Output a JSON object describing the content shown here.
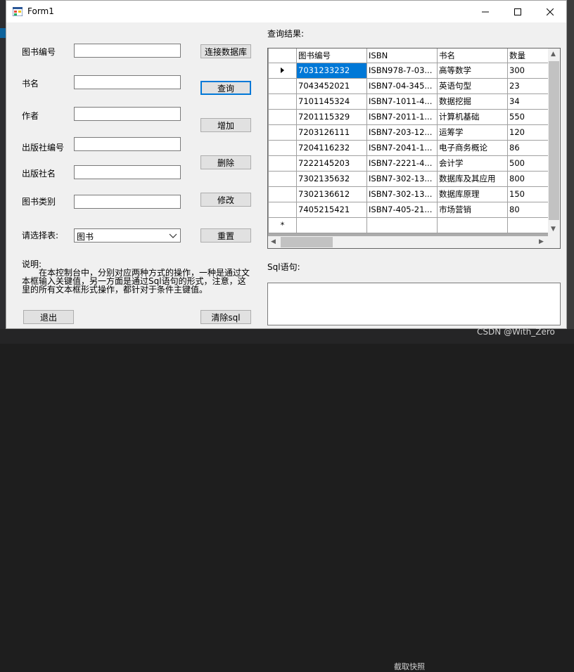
{
  "window": {
    "title": "Form1"
  },
  "form": {
    "labels": {
      "book_id": "图书编号",
      "book_name": "书名",
      "author": "作者",
      "publisher_id": "出版社编号",
      "publisher_name": "出版社名",
      "category": "图书类别",
      "choose_table": "请选择表:",
      "query_result": "查询结果:",
      "sql_statement": "Sql语句:"
    },
    "inputs": {
      "book_id": "",
      "book_name": "",
      "author": "",
      "publisher_id": "",
      "publisher_name": "",
      "category": ""
    },
    "table_select": {
      "value": "图书"
    },
    "buttons": {
      "connect": "连接数据库",
      "query": "查询",
      "add": "增加",
      "delete": "删除",
      "modify": "修改",
      "reset": "重置",
      "exit": "退出",
      "clear_sql": "清除sql"
    },
    "description": {
      "head": "说明:",
      "body": "在本控制台中，分别对应两种方式的操作，一种是通过文本框输入关键值，另一方面是通过Sql语句的形式，注意，这里的所有文本框形式操作，都针对于条件主键值。"
    },
    "sql_text": ""
  },
  "grid": {
    "columns": [
      "图书编号",
      "ISBN",
      "书名",
      "数量"
    ],
    "rows": [
      [
        "7031233232",
        "ISBN978-7-03...",
        "高等数学",
        "300"
      ],
      [
        "7043452021",
        "ISBN7-04-345...",
        "英语句型",
        "23"
      ],
      [
        "7101145324",
        "ISBN7-1011-4...",
        "数据挖掘",
        "34"
      ],
      [
        "7201115329",
        "ISBN7-2011-1...",
        "计算机基础",
        "550"
      ],
      [
        "7203126111",
        "ISBN7-203-12...",
        "运筹学",
        "120"
      ],
      [
        "7204116232",
        "ISBN7-2041-1...",
        "电子商务概论",
        "86"
      ],
      [
        "7222145203",
        "ISBN7-2221-4...",
        "会计学",
        "500"
      ],
      [
        "7302135632",
        "ISBN7-302-13...",
        "数据库及其应用",
        "800"
      ],
      [
        "7302136612",
        "ISBN7-302-13...",
        "数据库原理",
        "150"
      ],
      [
        "7405215421",
        "ISBN7-405-21...",
        "市场营销",
        "80"
      ]
    ],
    "new_row_marker": "*"
  },
  "background": {
    "watermark": "CSDN @With_Zero",
    "taskbar_text": "截取快照"
  },
  "colors": {
    "selection": "#0078d7",
    "focus_border": "#0078d7",
    "window_bg": "#f0f0f0"
  }
}
